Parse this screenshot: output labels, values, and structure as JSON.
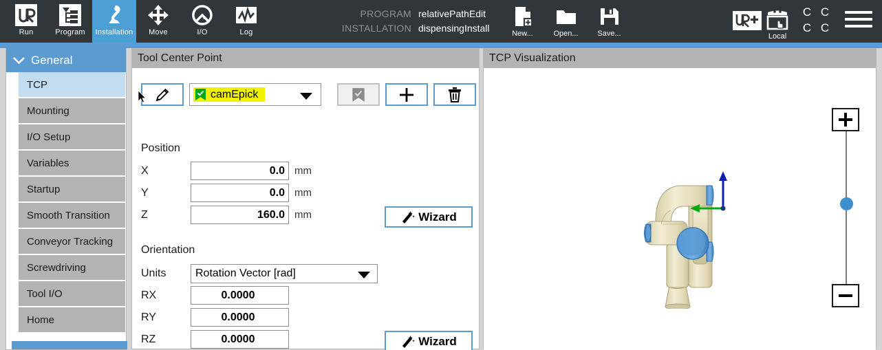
{
  "header": {
    "nav_tabs": [
      {
        "label": "Run",
        "icon": "ur-logo-icon",
        "active": false
      },
      {
        "label": "Program",
        "icon": "program-tree-icon",
        "active": false
      },
      {
        "label": "Installation",
        "icon": "robot-arm-icon",
        "active": true
      },
      {
        "label": "Move",
        "icon": "move-arrows-icon",
        "active": false
      },
      {
        "label": "I/O",
        "icon": "io-gauge-icon",
        "active": false
      },
      {
        "label": "Log",
        "icon": "log-waveform-icon",
        "active": false
      }
    ],
    "program_key": "PROGRAM",
    "program_value": "relativePathEdit",
    "installation_key": "INSTALLATION",
    "installation_value": "dispensingInstall",
    "file_buttons": [
      {
        "label": "New...",
        "icon": "new-file-icon"
      },
      {
        "label": "Open...",
        "icon": "open-folder-icon"
      },
      {
        "label": "Save...",
        "icon": "save-floppy-icon"
      }
    ],
    "urplus_icon": "ur-plus-icon",
    "local_label": "Local",
    "local_icon": "local-control-icon",
    "speed_indicators": [
      "C",
      "C",
      "C",
      "C"
    ],
    "menu_icon": "hamburger-menu-icon"
  },
  "sidebar": {
    "section_title": "General",
    "section_icon": "chevron-down-icon",
    "items": [
      {
        "label": "TCP",
        "selected": true
      },
      {
        "label": "Mounting",
        "selected": false
      },
      {
        "label": "I/O Setup",
        "selected": false
      },
      {
        "label": "Variables",
        "selected": false
      },
      {
        "label": "Startup",
        "selected": false
      },
      {
        "label": "Smooth Transition",
        "selected": false
      },
      {
        "label": "Conveyor Tracking",
        "selected": false
      },
      {
        "label": "Screwdriving",
        "selected": false
      },
      {
        "label": "Tool I/O",
        "selected": false
      },
      {
        "label": "Home",
        "selected": false
      }
    ]
  },
  "tcp_panel": {
    "title": "Tool Center Point",
    "toolbar": {
      "edit_icon": "pencil-edit-icon",
      "selected_tcp": "camEpick",
      "tcp_flag_icon": "green-check-bookmark-icon",
      "dropdown_icon": "chevron-down-icon",
      "set_default_icon": "bookmark-check-icon",
      "add_icon": "plus-icon",
      "delete_icon": "trash-icon"
    },
    "position": {
      "title": "Position",
      "fields": [
        {
          "label": "X",
          "value": "0.0",
          "unit": "mm"
        },
        {
          "label": "Y",
          "value": "0.0",
          "unit": "mm"
        },
        {
          "label": "Z",
          "value": "160.0",
          "unit": "mm"
        }
      ],
      "wizard_label": "Wizard",
      "wizard_icon": "magic-wand-icon"
    },
    "orientation": {
      "title": "Orientation",
      "units_label": "Units",
      "units_value": "Rotation Vector [rad]",
      "fields": [
        {
          "label": "RX",
          "value": "0.0000"
        },
        {
          "label": "RY",
          "value": "0.0000"
        },
        {
          "label": "RZ",
          "value": "0.0000"
        }
      ],
      "wizard_label": "Wizard",
      "wizard_icon": "magic-wand-icon"
    }
  },
  "viz_panel": {
    "title": "TCP Visualization",
    "robot_icon": "ur-robot-3d-model",
    "tcp_axes_icon": "tcp-coordinate-axes",
    "zoom_in_icon": "plus-icon",
    "zoom_out_icon": "minus-icon",
    "zoom_handle_icon": "slider-handle"
  },
  "colors": {
    "header_bg": "#31363b",
    "accent_blue": "#5b9bd0",
    "active_tab": "#4b9fd5",
    "sidebar_item": "#b3b3b3",
    "sidebar_selected": "#c2dcf2",
    "highlight_yellow": "#f2f200",
    "flag_green": "#00a71c",
    "panel_head": "#b3b3b3",
    "page_bg": "#d4d4d4"
  }
}
